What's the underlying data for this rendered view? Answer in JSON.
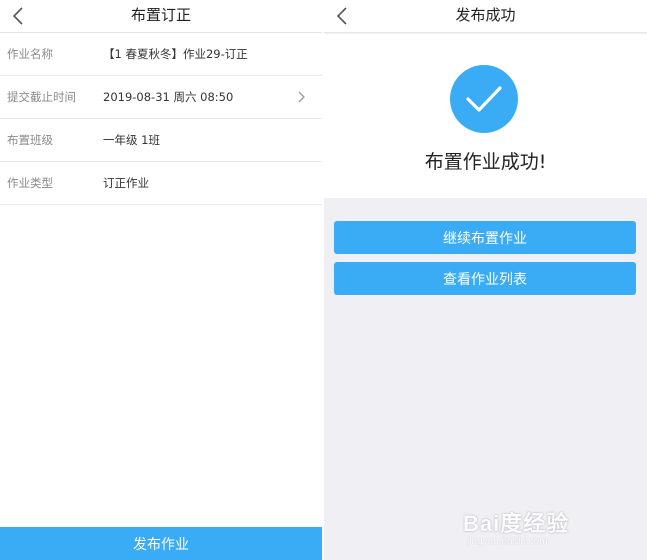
{
  "left": {
    "title": "布置订正",
    "back_icon": "chevron-left-icon",
    "rows": [
      {
        "label": "作业名称",
        "value": "【1 春夏秋冬】作业29-订正"
      },
      {
        "label": "提交截止时间",
        "value": "2019-08-31 周六 08:50"
      },
      {
        "label": "布置班级",
        "value": "一年级 1班"
      },
      {
        "label": "作业类型",
        "value": "订正作业"
      }
    ],
    "publish_label": "发布作业"
  },
  "right": {
    "title": "发布成功",
    "back_icon": "chevron-left-icon",
    "success_icon": "check-icon",
    "success_text": "布置作业成功!",
    "continue_label": "继续布置作业",
    "view_list_label": "查看作业列表"
  },
  "watermark": {
    "logo": "Bai度经验",
    "sub": "jingyan.baidu.com"
  },
  "colors": {
    "accent": "#3aacf5",
    "page_bg": "#efeff4"
  }
}
